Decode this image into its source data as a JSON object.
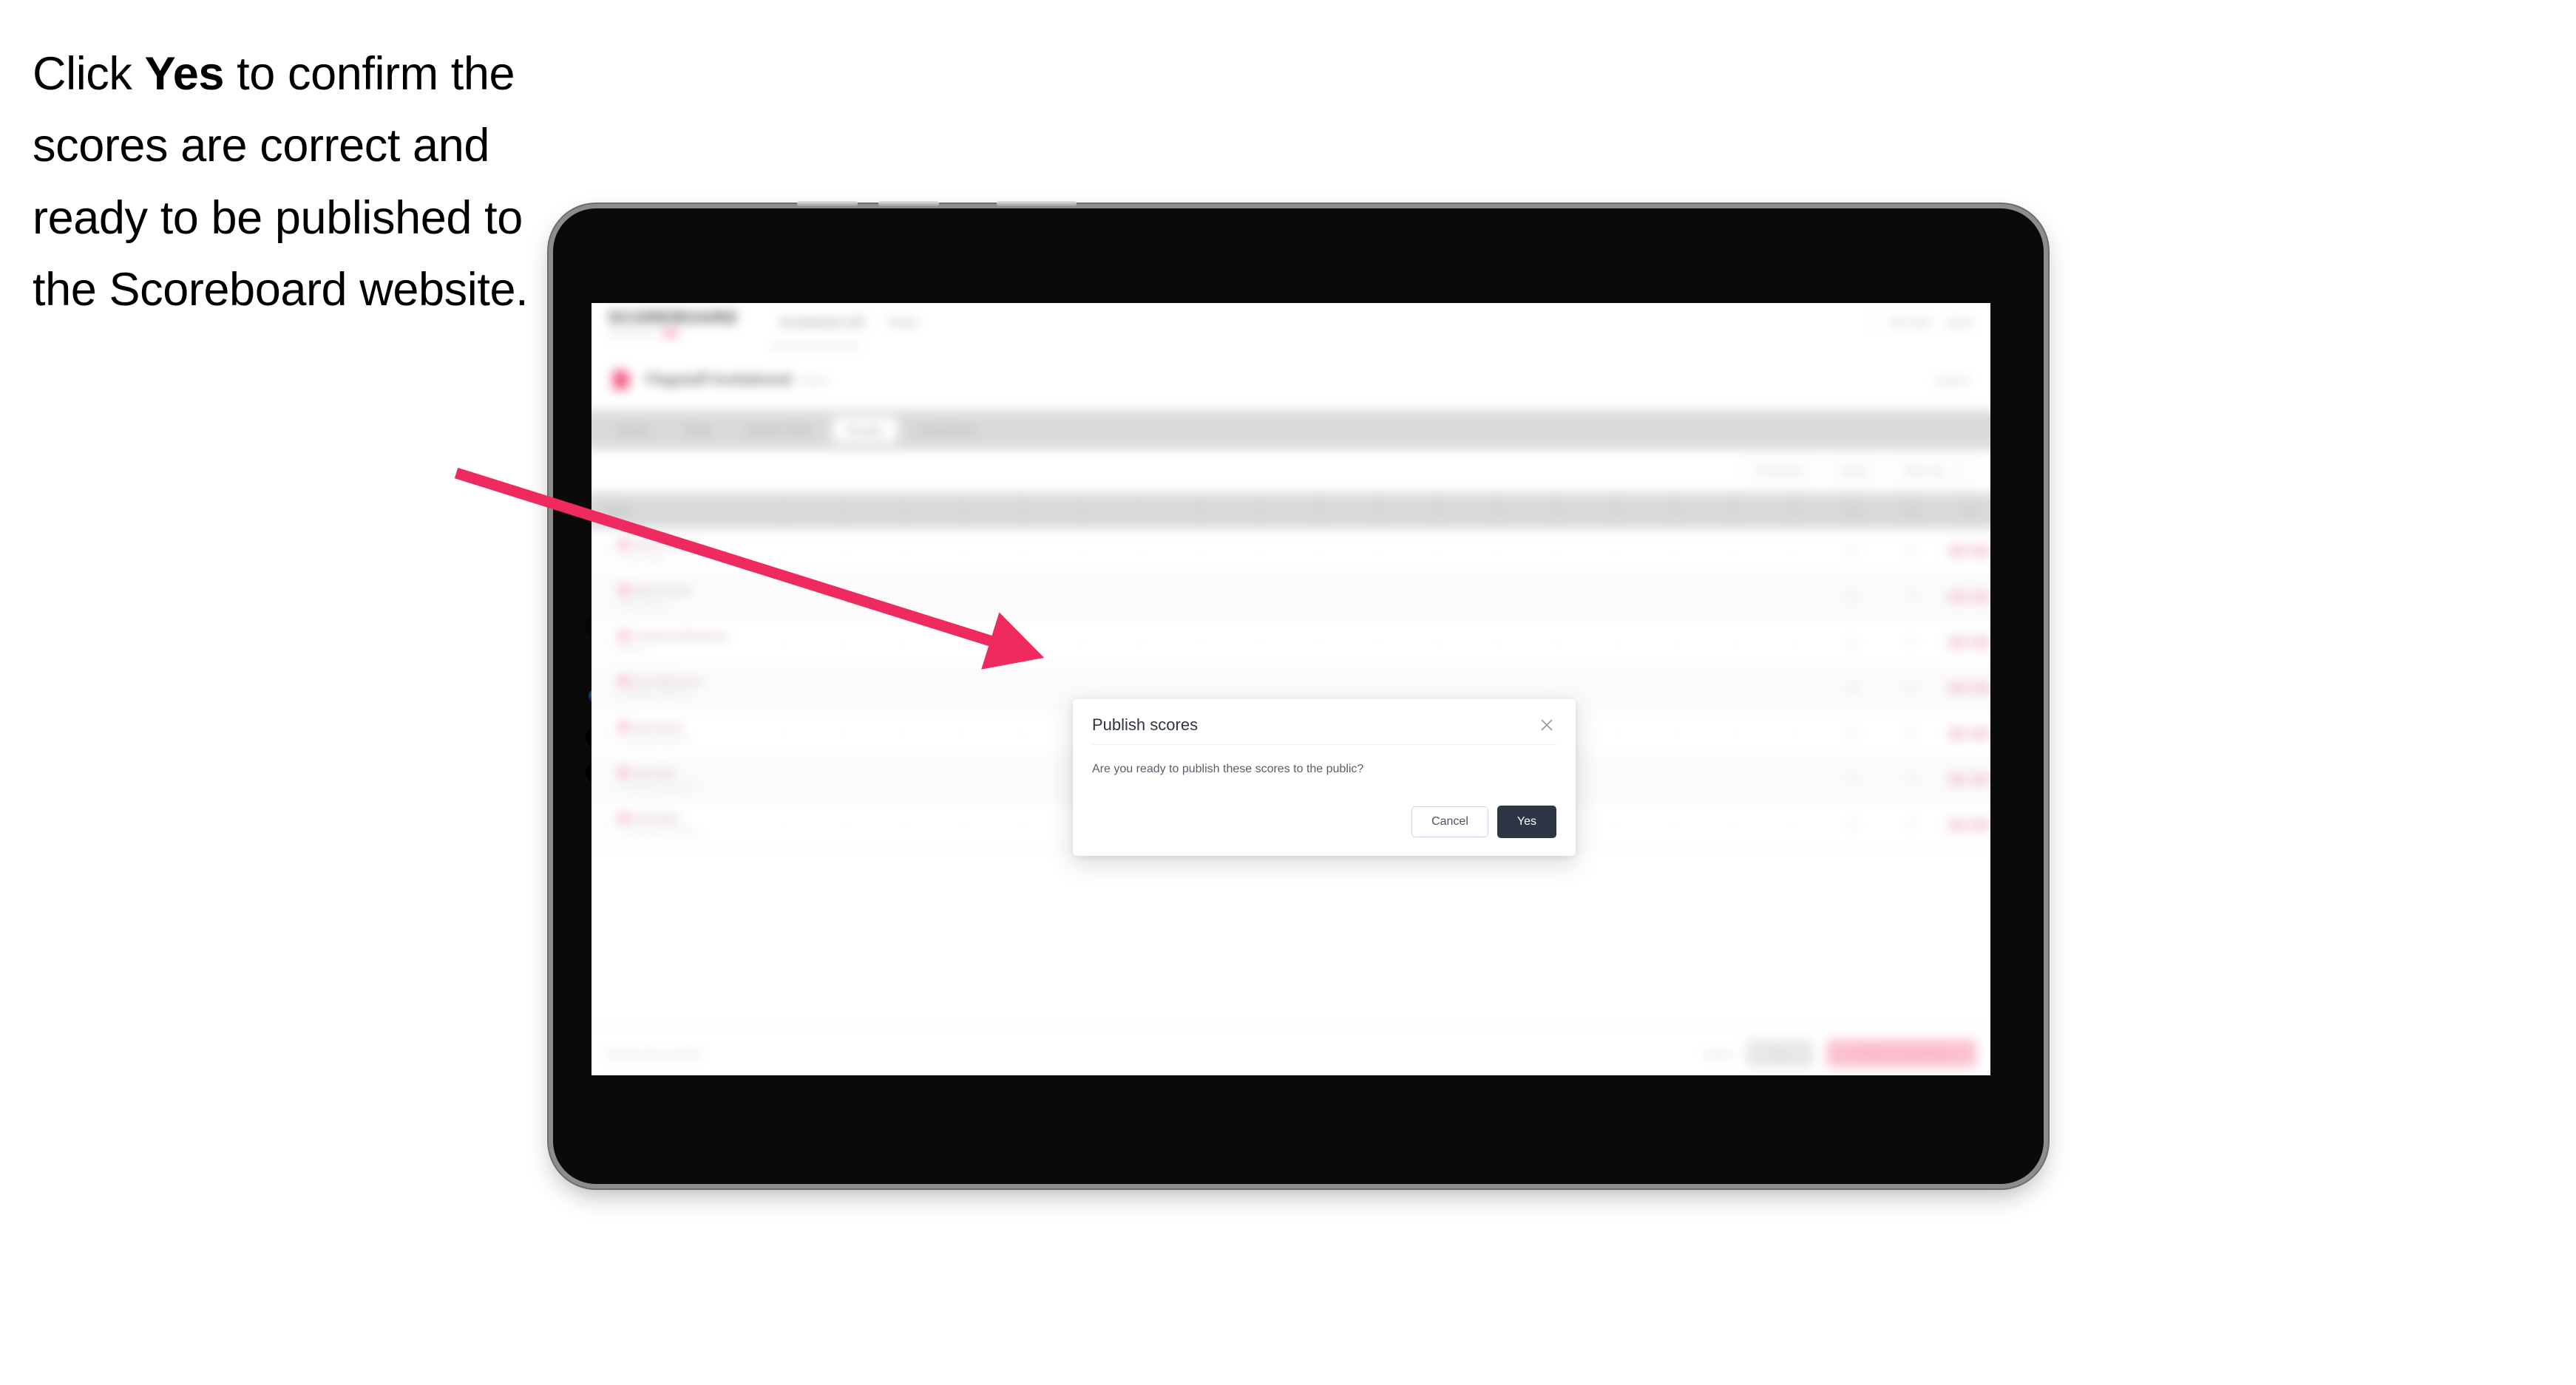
{
  "caption": {
    "before": "Click ",
    "emphasis": "Yes",
    "after": " to confirm the scores are correct and ready to be published to the Scoreboard website."
  },
  "colors": {
    "arrow": "#ee2a5f",
    "primary_button": "#2c3645",
    "accent_pink": "#f1567e",
    "device_body": "#0a0a0a",
    "device_rail": "#9a9a9a"
  },
  "modal": {
    "title": "Publish scores",
    "body": "Are you ready to publish these scores to the public?",
    "close_icon": "close-icon",
    "cancel_label": "Cancel",
    "confirm_label": "Yes"
  },
  "app": {
    "brand": {
      "word": "SCOREBOARD",
      "sub": "POWERED BY"
    },
    "nav_links": [
      "Scoreboard LIVE",
      "Panel"
    ],
    "nav_right": [
      "My Clubs",
      "Admin"
    ],
    "title": {
      "mark": "event-logo",
      "name": "Flagstaff Invitational",
      "sub": "Event",
      "right": "Level 3"
    },
    "tabs": [
      "Details",
      "Setup",
      "Session Order",
      "Results",
      "Leaderboard"
    ],
    "active_tab": "Results",
    "filters": [
      "All Sessions",
      "Round",
      "Team only"
    ],
    "table": {
      "columns": [
        "Player",
        "1",
        "2",
        "3",
        "4",
        "5",
        "6",
        "7",
        "8",
        "9",
        "10",
        "11",
        "12",
        "13",
        "14",
        "15",
        "16",
        "17",
        "18",
        "Total",
        "Place",
        "Score"
      ],
      "rows": [
        {
          "name": "Marion Deters",
          "club": "Flower Village",
          "place": "84",
          "rank": "76"
        },
        {
          "name": "Ellen Purcell",
          "club": "Flower Village",
          "place": "86",
          "rank": "79"
        },
        {
          "name": "Contessa Robertson",
          "club": "Bellevue",
          "place": "81",
          "rank": "74"
        },
        {
          "name": "Erin Halverson",
          "club": "Scoreboard Club City",
          "place": "88",
          "rank": "87"
        },
        {
          "name": "Dana Bush",
          "club": "Scoreboard Club City",
          "place": "90",
          "rank": "85"
        },
        {
          "name": "Sara Bolt",
          "club": "Scoreboard Gymnastics",
          "place": "92",
          "rank": "78"
        },
        {
          "name": "Bob Baker",
          "club": "Scoreboard Gymnastics",
          "place": "82",
          "rank": "75"
        }
      ]
    },
    "footer": {
      "note": "Not all scores are final",
      "link": "Cancel",
      "secondary_button": "Save",
      "primary_button": "Publish to Scoreboard"
    }
  },
  "device": {
    "type": "tablet",
    "buttons": [
      "volume-up-button",
      "volume-down-button",
      "power-button"
    ],
    "camera": "front-camera"
  }
}
